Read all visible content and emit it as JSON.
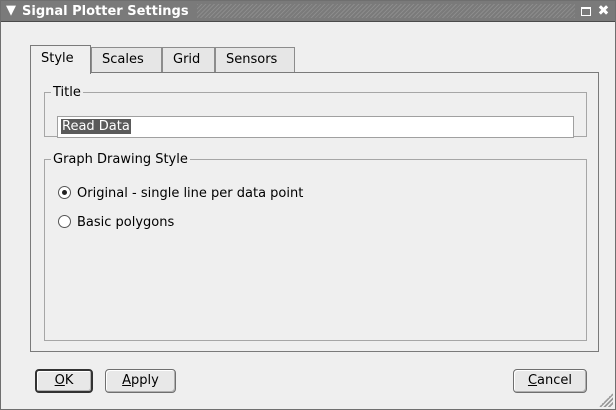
{
  "window": {
    "title": "Signal Plotter Settings"
  },
  "tabs": [
    {
      "label": "Style",
      "active": true
    },
    {
      "label": "Scales",
      "active": false
    },
    {
      "label": "Grid",
      "active": false
    },
    {
      "label": "Sensors",
      "active": false
    }
  ],
  "style_tab": {
    "title_group": {
      "legend": "Title",
      "value": "Read Data"
    },
    "drawing_group": {
      "legend": "Graph Drawing Style",
      "options": [
        {
          "label": "Original - single line per data point",
          "checked": true
        },
        {
          "label": "Basic polygons",
          "checked": false
        }
      ]
    }
  },
  "buttons": {
    "ok_mnemonic": "O",
    "ok_rest": "K",
    "apply_mnemonic": "A",
    "apply_rest": "pply",
    "cancel_mnemonic": "C",
    "cancel_rest": "ancel"
  },
  "icons": {
    "menu": "chevron-down-icon",
    "maximize": "maximize-icon",
    "close": "close-icon"
  }
}
